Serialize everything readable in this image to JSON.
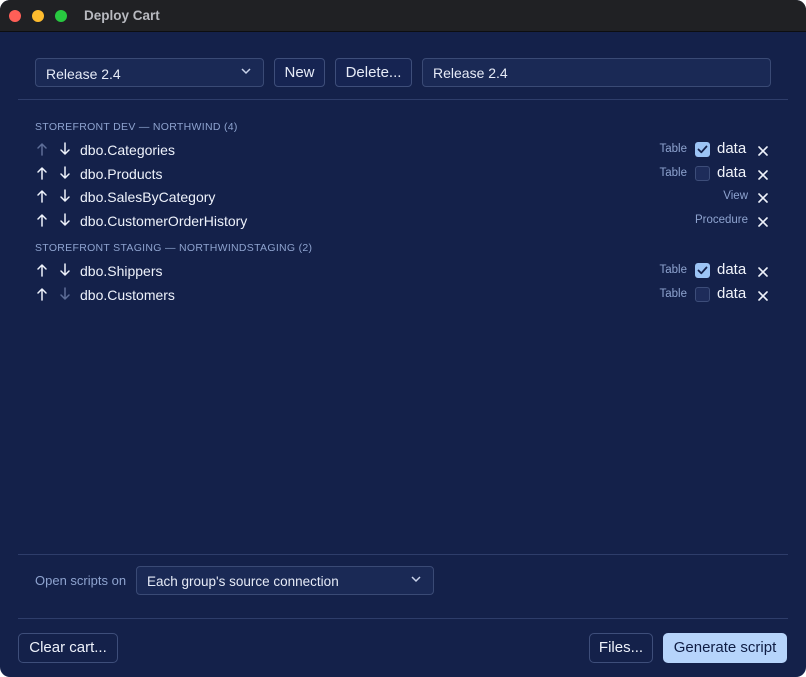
{
  "window": {
    "title": "Deploy Cart"
  },
  "toolbar": {
    "cart_select": "Release 2.4",
    "new_label": "New",
    "delete_label": "Delete...",
    "cart_name": "Release 2.4"
  },
  "groups": [
    {
      "header": "STOREFRONT DEV — NORTHWIND (4)",
      "items": [
        {
          "name": "dbo.Categories",
          "type": "Table",
          "has_data": true,
          "data_checked": true,
          "up_enabled": false,
          "down_enabled": true
        },
        {
          "name": "dbo.Products",
          "type": "Table",
          "has_data": true,
          "data_checked": false,
          "up_enabled": true,
          "down_enabled": true
        },
        {
          "name": "dbo.SalesByCategory",
          "type": "View",
          "has_data": false,
          "data_checked": false,
          "up_enabled": true,
          "down_enabled": true
        },
        {
          "name": "dbo.CustomerOrderHistory",
          "type": "Procedure",
          "has_data": false,
          "data_checked": false,
          "up_enabled": true,
          "down_enabled": true
        }
      ]
    },
    {
      "header": "STOREFRONT STAGING — NORTHWINDSTAGING (2)",
      "items": [
        {
          "name": "dbo.Shippers",
          "type": "Table",
          "has_data": true,
          "data_checked": true,
          "up_enabled": true,
          "down_enabled": true
        },
        {
          "name": "dbo.Customers",
          "type": "Table",
          "has_data": true,
          "data_checked": false,
          "up_enabled": true,
          "down_enabled": false
        }
      ]
    }
  ],
  "data_label": "data",
  "footer": {
    "open_label": "Open scripts on",
    "open_select": "Each group's source connection",
    "clear_label": "Clear cart...",
    "files_label": "Files...",
    "generate_label": "Generate script"
  },
  "colors": {
    "background": "#14214a",
    "accent": "#b6d4fb",
    "checkbox_on": "#9cc4f5"
  }
}
